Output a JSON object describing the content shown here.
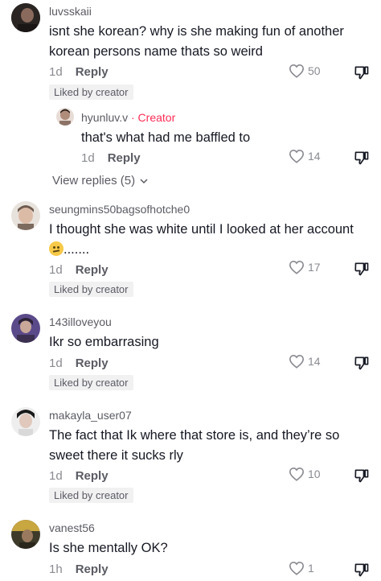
{
  "comments": [
    {
      "username": "luvsskaii",
      "text": "isnt she korean? why is she making fun of another korean persons name thats so weird",
      "time": "1d",
      "reply_label": "Reply",
      "likes": "50",
      "liked_by_creator": "Liked by creator",
      "avatar_color": "#2a2523",
      "replies": [
        {
          "username": "hyunluv.v",
          "creator_tag": "· Creator",
          "text": "that's what had me baffled to",
          "time": "1d",
          "reply_label": "Reply",
          "likes": "14",
          "avatar_color": "#b08c7a"
        }
      ],
      "view_replies": "View replies (5)"
    },
    {
      "username": "seungmins50bagsofhotche0",
      "text": "I thought she was white until I looked at her account",
      "text_suffix": ".......",
      "time": "1d",
      "reply_label": "Reply",
      "likes": "17",
      "liked_by_creator": "Liked by creator",
      "avatar_color": "#7c6a5e"
    },
    {
      "username": "143illoveyou",
      "text": "Ikr so embarrasing",
      "time": "1d",
      "reply_label": "Reply",
      "likes": "14",
      "liked_by_creator": "Liked by creator",
      "avatar_color": "#5b4a8a"
    },
    {
      "username": "makayla_user07",
      "text": "The fact that Ik where that store is, and they’re so sweet there it sucks rly",
      "time": "1d",
      "reply_label": "Reply",
      "likes": "10",
      "liked_by_creator": "Liked by creator",
      "avatar_color": "#d9d9d9"
    },
    {
      "username": "vanest56",
      "text": "Is she mentally OK?",
      "time": "1h",
      "reply_label": "Reply",
      "likes": "1",
      "avatar_color": "#3d3a2a"
    }
  ]
}
